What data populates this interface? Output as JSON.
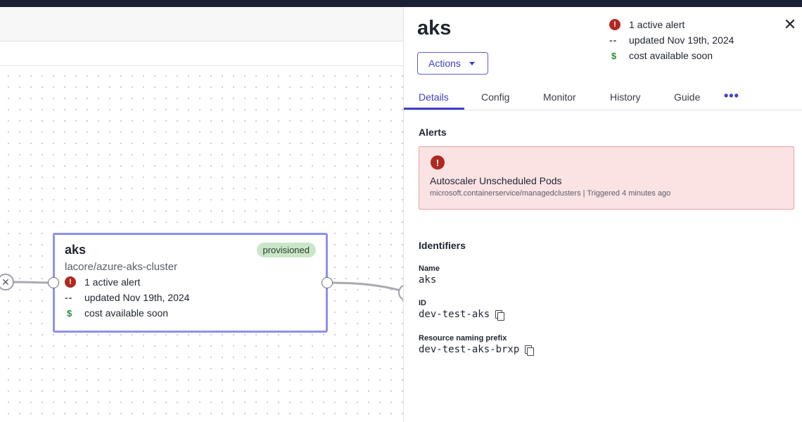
{
  "node": {
    "title": "aks",
    "badge": "provisioned",
    "subtitle": "lacore/azure-aks-cluster",
    "alert_text": "1 active alert",
    "updated_text": "updated Nov 19th, 2024",
    "cost_text": "cost available soon"
  },
  "panel": {
    "title": "aks",
    "meta": {
      "alert_text": "1 active alert",
      "updated_text": "updated Nov 19th, 2024",
      "cost_text": "cost available soon"
    },
    "actions_label": "Actions",
    "tabs": [
      {
        "label": "Details",
        "active": true
      },
      {
        "label": "Config",
        "active": false
      },
      {
        "label": "Monitor",
        "active": false
      },
      {
        "label": "History",
        "active": false
      },
      {
        "label": "Guide",
        "active": false
      }
    ],
    "more_label": "•••",
    "alerts_heading": "Alerts",
    "alert": {
      "name": "Autoscaler Unscheduled Pods",
      "detail": "microsoft.containerservice/managedclusters | Triggered 4 minutes ago"
    },
    "identifiers_heading": "Identifiers",
    "identifiers": [
      {
        "label": "Name",
        "value": "aks",
        "copyable": false
      },
      {
        "label": "ID",
        "value": "dev-test-aks",
        "copyable": true
      },
      {
        "label": "Resource naming prefix",
        "value": "dev-test-aks-brxp",
        "copyable": true
      }
    ]
  },
  "icons": {
    "alert": "alert-circle-icon",
    "updated": "dash-icon",
    "cost": "dollar-icon",
    "close": "close-icon",
    "caret": "chevron-down-icon",
    "copy": "copy-icon",
    "remove": "x-circle-icon"
  },
  "colors": {
    "accent": "#3d40c9",
    "node_border": "#8f8ff0",
    "alert_red": "#b0281f",
    "alert_bg": "#fbe3e4",
    "badge_bg": "#c9e6c9",
    "dollar_green": "#2e8b3a"
  }
}
